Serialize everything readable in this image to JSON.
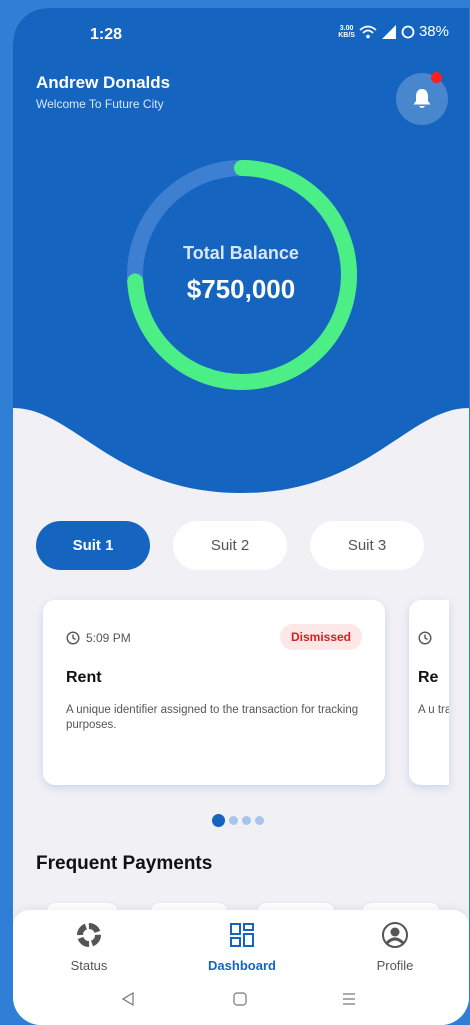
{
  "status_bar": {
    "time": "1:28",
    "net_speed_value": "3.00",
    "net_speed_unit": "KB/S",
    "battery": "38%"
  },
  "header": {
    "user_name": "Andrew Donalds",
    "welcome": "Welcome To Future City",
    "has_unread_notification": true
  },
  "balance": {
    "label": "Total Balance",
    "amount": "$750,000",
    "progress_fraction": 0.74
  },
  "tabs": [
    {
      "label": "Suit 1",
      "active": true
    },
    {
      "label": "Suit 2",
      "active": false
    },
    {
      "label": "Suit 3",
      "active": false
    }
  ],
  "cards": [
    {
      "time": "5:09 PM",
      "status": "Dismissed",
      "title": "Rent",
      "description": "A unique identifier assigned to the transaction for tracking purposes."
    },
    {
      "title": "Re",
      "description": "A u tra"
    }
  ],
  "carousel": {
    "count": 4,
    "active_index": 0
  },
  "sections": {
    "frequent_payments": "Frequent Payments"
  },
  "bottom_nav": [
    {
      "label": "Status",
      "icon": "status-ring-icon",
      "active": false
    },
    {
      "label": "Dashboard",
      "icon": "dashboard-grid-icon",
      "active": true
    },
    {
      "label": "Profile",
      "icon": "profile-circle-icon",
      "active": false
    }
  ],
  "colors": {
    "primary": "#1565c0",
    "ring_progress": "#4cee86",
    "ring_track": "#3d7fd0",
    "badge_text": "#d61f1f",
    "badge_bg": "#fde8e8"
  }
}
